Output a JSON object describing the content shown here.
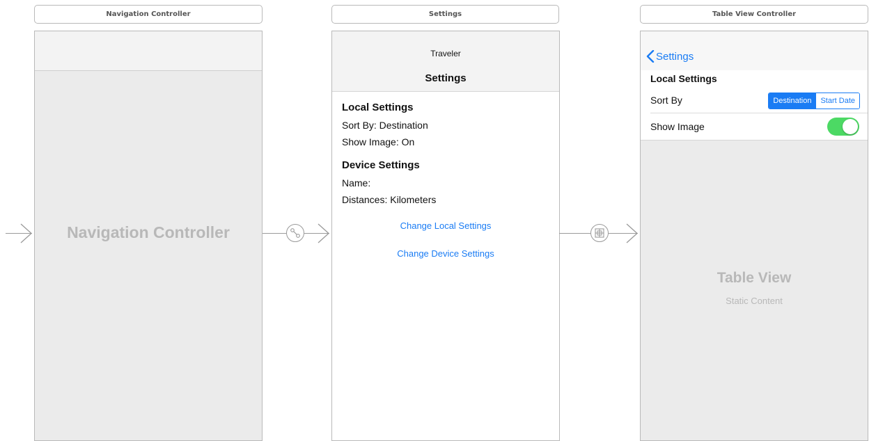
{
  "scenes": {
    "nav": {
      "title": "Navigation Controller",
      "placeholder": "Navigation Controller"
    },
    "settings": {
      "title": "Settings",
      "prompt": "Traveler",
      "nav_title": "Settings",
      "local_heading": "Local Settings",
      "sort_by": "Sort By: Destination",
      "show_image": "Show Image: On",
      "device_heading": "Device Settings",
      "name": "Name:",
      "distances": "Distances: Kilometers",
      "change_local": "Change Local Settings",
      "change_device": "Change Device Settings"
    },
    "table": {
      "title": "Table View Controller",
      "back_label": "Settings",
      "section_header": "Local Settings",
      "sort_by_label": "Sort By",
      "segments": [
        "Destination",
        "Start Date"
      ],
      "selected_segment": "Destination",
      "show_image_label": "Show Image",
      "show_image_on": true,
      "placeholder_title": "Table View",
      "placeholder_subtitle": "Static Content"
    }
  },
  "segues": {
    "entry": {
      "icon": "initial-arrow-icon"
    },
    "relationship": {
      "icon": "relationship-segue-icon"
    },
    "show": {
      "icon": "show-segue-icon"
    }
  },
  "colors": {
    "accent": "#1a7cf4",
    "toggle_on": "#4cd964",
    "placeholder_text": "#b8b8b8",
    "scene_border": "#b9b9b9"
  }
}
